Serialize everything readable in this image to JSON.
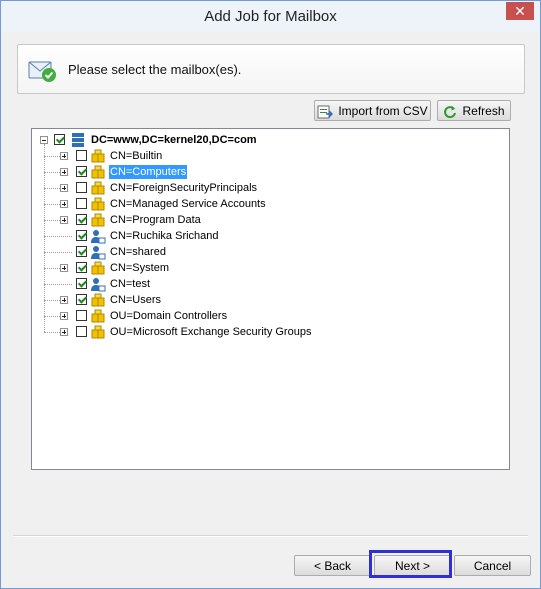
{
  "window": {
    "title": "Add Job for Mailbox",
    "close_glyph": "✕"
  },
  "header": {
    "text": "Please select the mailbox(es).",
    "icon": "mail-check-icon"
  },
  "toolbar": {
    "import_label": "Import from CSV",
    "refresh_label": "Refresh"
  },
  "tree": {
    "root": {
      "label": "DC=www,DC=kernel20,DC=com",
      "checked": true
    },
    "items": [
      {
        "label": "CN=Builtin",
        "checked": false,
        "type": "folder",
        "expandable": true
      },
      {
        "label": "CN=Computers",
        "checked": true,
        "type": "folder",
        "expandable": true,
        "selected": true
      },
      {
        "label": "CN=ForeignSecurityPrincipals",
        "checked": false,
        "type": "folder",
        "expandable": true
      },
      {
        "label": "CN=Managed Service Accounts",
        "checked": false,
        "type": "folder",
        "expandable": true
      },
      {
        "label": "CN=Program Data",
        "checked": true,
        "type": "folder",
        "expandable": true
      },
      {
        "label": "CN=Ruchika Srichand",
        "checked": true,
        "type": "user",
        "expandable": false
      },
      {
        "label": "CN=shared",
        "checked": true,
        "type": "user",
        "expandable": false
      },
      {
        "label": "CN=System",
        "checked": true,
        "type": "folder",
        "expandable": true
      },
      {
        "label": "CN=test",
        "checked": true,
        "type": "user",
        "expandable": false
      },
      {
        "label": "CN=Users",
        "checked": true,
        "type": "folder",
        "expandable": true
      },
      {
        "label": "OU=Domain Controllers",
        "checked": false,
        "type": "folder",
        "expandable": true
      },
      {
        "label": "OU=Microsoft Exchange Security Groups",
        "checked": false,
        "type": "folder",
        "expandable": true
      }
    ]
  },
  "footer": {
    "back_label": "< Back",
    "next_label": "Next >",
    "cancel_label": "Cancel"
  },
  "colors": {
    "accent_highlight": "#2f2fd6",
    "selection": "#3399ff",
    "check": "#1a8a1a"
  }
}
